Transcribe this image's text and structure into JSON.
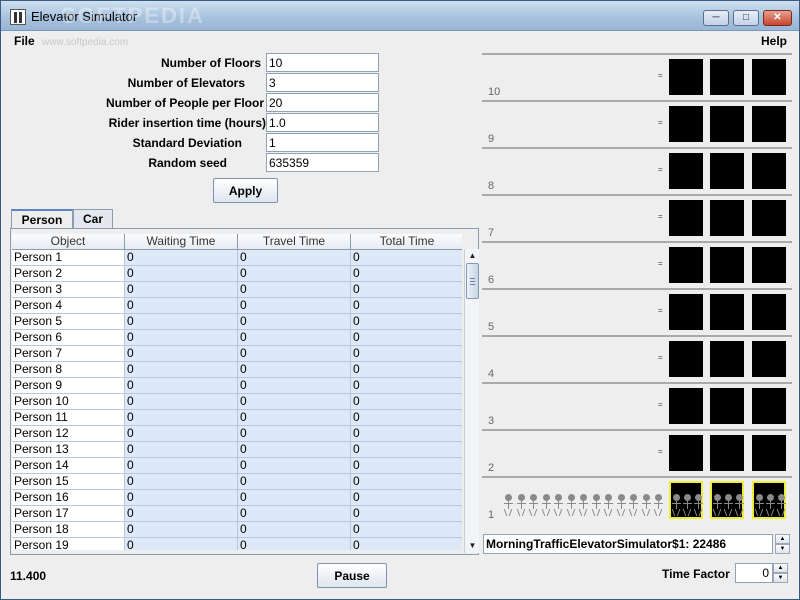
{
  "window": {
    "title": "Elevator Simulator",
    "watermark": "SOFTPEDIA"
  },
  "menubar": {
    "file": "File",
    "help": "Help",
    "url": "www.softpedia.com"
  },
  "form": {
    "fields": [
      {
        "label": "Number of Floors",
        "value": "10"
      },
      {
        "label": "Number of Elevators",
        "value": "3"
      },
      {
        "label": "Number of People per Floor",
        "value": "20"
      },
      {
        "label": "Rider insertion time (hours)",
        "value": "1.0"
      },
      {
        "label": "Standard Deviation",
        "value": "1"
      },
      {
        "label": "Random seed",
        "value": "635359"
      }
    ],
    "apply_label": "Apply"
  },
  "tabs": [
    {
      "label": "Person"
    },
    {
      "label": "Car"
    }
  ],
  "table": {
    "columns": [
      "Object",
      "Waiting Time",
      "Travel Time",
      "Total Time"
    ],
    "rows": [
      [
        "Person 1",
        "0",
        "0",
        "0"
      ],
      [
        "Person 2",
        "0",
        "0",
        "0"
      ],
      [
        "Person 3",
        "0",
        "0",
        "0"
      ],
      [
        "Person 4",
        "0",
        "0",
        "0"
      ],
      [
        "Person 5",
        "0",
        "0",
        "0"
      ],
      [
        "Person 6",
        "0",
        "0",
        "0"
      ],
      [
        "Person 7",
        "0",
        "0",
        "0"
      ],
      [
        "Person 8",
        "0",
        "0",
        "0"
      ],
      [
        "Person 9",
        "0",
        "0",
        "0"
      ],
      [
        "Person 10",
        "0",
        "0",
        "0"
      ],
      [
        "Person 11",
        "0",
        "0",
        "0"
      ],
      [
        "Person 12",
        "0",
        "0",
        "0"
      ],
      [
        "Person 13",
        "0",
        "0",
        "0"
      ],
      [
        "Person 14",
        "0",
        "0",
        "0"
      ],
      [
        "Person 15",
        "0",
        "0",
        "0"
      ],
      [
        "Person 16",
        "0",
        "0",
        "0"
      ],
      [
        "Person 17",
        "0",
        "0",
        "0"
      ],
      [
        "Person 18",
        "0",
        "0",
        "0"
      ],
      [
        "Person 19",
        "0",
        "0",
        "0"
      ]
    ]
  },
  "footer": {
    "time": "11.400",
    "pause_label": "Pause"
  },
  "building": {
    "floors": [
      "10",
      "9",
      "8",
      "7",
      "6",
      "5",
      "4",
      "3",
      "2",
      "1"
    ],
    "elevator_count": 3,
    "people_waiting_ground": 13,
    "car_highlight_color": "#f0ec3c"
  },
  "simulator": {
    "status": "MorningTrafficElevatorSimulator$1: 22486"
  },
  "time_factor": {
    "label": "Time Factor",
    "value": "0"
  }
}
